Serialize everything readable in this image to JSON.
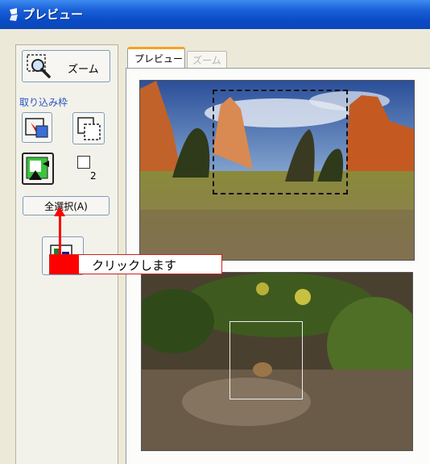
{
  "window": {
    "title": "プレビュー"
  },
  "sidebar": {
    "zoom_button_label": "ズーム",
    "section_label": "取り込み枠",
    "frame_count": "2",
    "select_all_label": "全選択(A)"
  },
  "tabs": [
    {
      "label": "プレビュー",
      "active": true
    },
    {
      "label": "ズーム",
      "active": false
    }
  ],
  "callout": {
    "text": "クリックします"
  },
  "colors": {
    "accent_red": "#ff0000",
    "titlebar_blue": "#0a4cc6",
    "tab_highlight": "#f5a320"
  }
}
